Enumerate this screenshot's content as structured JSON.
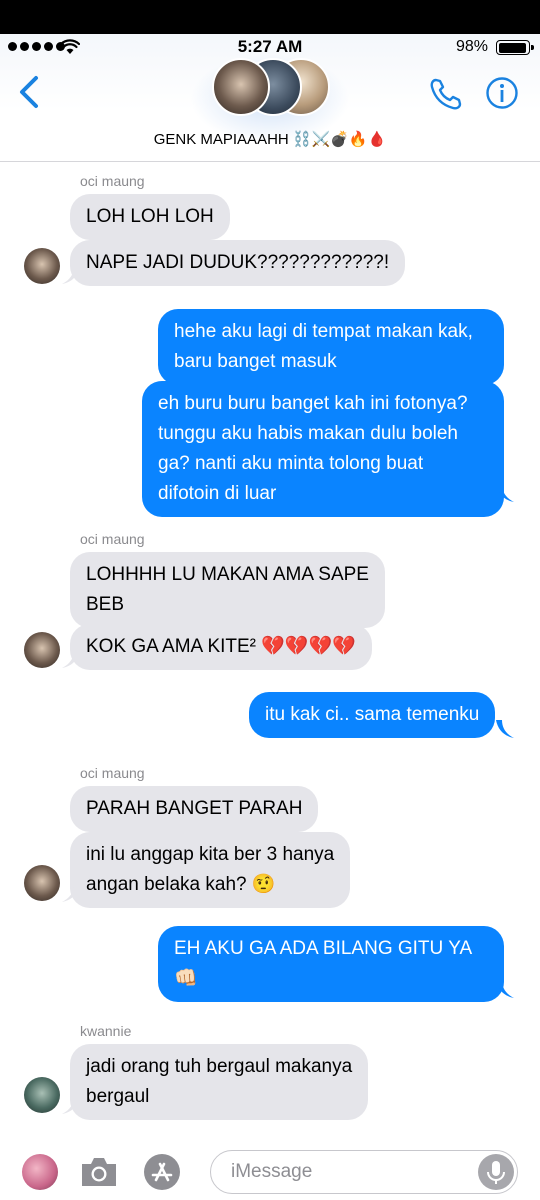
{
  "status_bar": {
    "time": "5:27 AM",
    "battery": "98%"
  },
  "header": {
    "group_name": "GENK MAPIAAAHH ⛓️⚔️💣🔥🩸",
    "icons": [
      "chevron-left-icon",
      "phone-icon",
      "info-icon"
    ]
  },
  "messages": [
    {
      "sender": "oci maung"
    },
    {
      "text": "LOH LOH LOH",
      "dir": "in"
    },
    {
      "text": "NAPE JADI DUDUK????????????!",
      "dir": "in"
    },
    {
      "lines": [
        "hehe aku lagi di tempat makan kak,",
        "baru banget masuk"
      ],
      "dir": "out"
    },
    {
      "lines": [
        "eh buru buru banget kah ini fotonya?",
        "tunggu aku habis makan dulu boleh",
        "ga? nanti aku minta tolong buat",
        "difotoin di luar"
      ],
      "dir": "out"
    },
    {
      "sender": "oci maung"
    },
    {
      "lines": [
        "LOHHHH LU MAKAN AMA SAPE",
        "BEB"
      ],
      "dir": "in"
    },
    {
      "text": "KOK GA AMA KITE² 💔💔💔💔",
      "dir": "in"
    },
    {
      "text": "itu kak ci.. sama temenku",
      "dir": "out"
    },
    {
      "sender": "oci maung"
    },
    {
      "text": "PARAH BANGET PARAH",
      "dir": "in"
    },
    {
      "lines": [
        "ini lu anggap kita ber 3 hanya",
        "angan belaka kah? 🤨"
      ],
      "dir": "in"
    },
    {
      "lines": [
        "EH AKU GA ADA BILANG GITU YA",
        "👊🏻"
      ],
      "dir": "out"
    },
    {
      "sender": "kwannie"
    },
    {
      "lines": [
        "jadi orang tuh bergaul makanya",
        "bergaul"
      ],
      "dir": "in"
    }
  ],
  "composer": {
    "placeholder": "iMessage",
    "icons": [
      "camera-icon",
      "app-store-icon",
      "microphone-icon"
    ]
  },
  "colors": {
    "outgoing": "#0a84ff",
    "incoming": "#e5e5ea",
    "accent": "#1a82e0"
  }
}
